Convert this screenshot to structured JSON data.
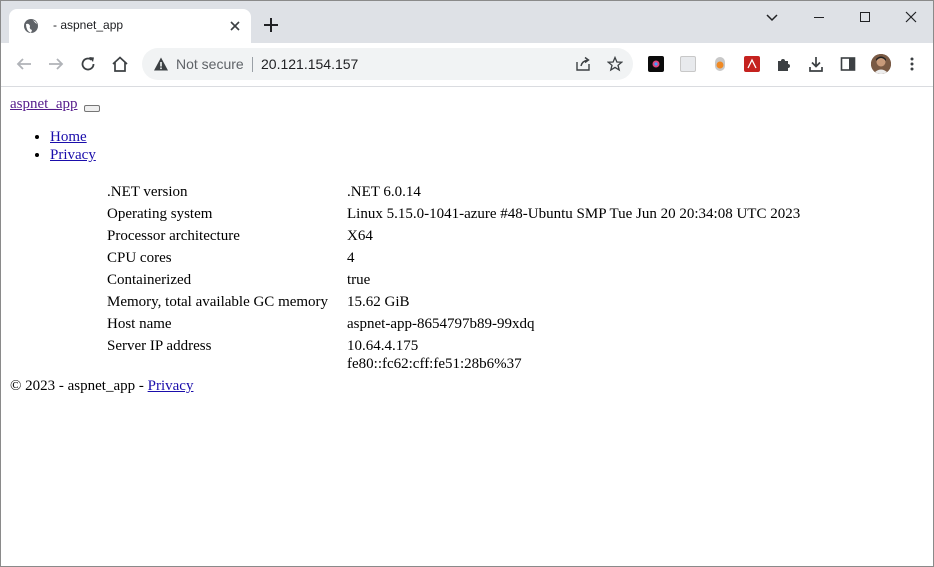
{
  "browser": {
    "tab_title": "- aspnet_app",
    "not_secure": "Not secure",
    "url": "20.121.154.157"
  },
  "page": {
    "brand": "aspnet_app",
    "nav": [
      "Home",
      "Privacy"
    ],
    "rows": [
      {
        "label": ".NET version",
        "value": ".NET 6.0.14"
      },
      {
        "label": "Operating system",
        "value": "Linux 5.15.0-1041-azure #48-Ubuntu SMP Tue Jun 20 20:34:08 UTC 2023"
      },
      {
        "label": "Processor architecture",
        "value": "X64"
      },
      {
        "label": "CPU cores",
        "value": "4"
      },
      {
        "label": "Containerized",
        "value": "true"
      },
      {
        "label": "Memory, total available GC memory",
        "value": "15.62 GiB"
      },
      {
        "label": "Host name",
        "value": "aspnet-app-8654797b89-99xdq"
      },
      {
        "label": "Server IP address",
        "value": "10.64.4.175",
        "value2": "fe80::fc62:cff:fe51:28b6%37"
      }
    ],
    "footer_text": "© 2023 - aspnet_app - ",
    "footer_link": "Privacy"
  }
}
